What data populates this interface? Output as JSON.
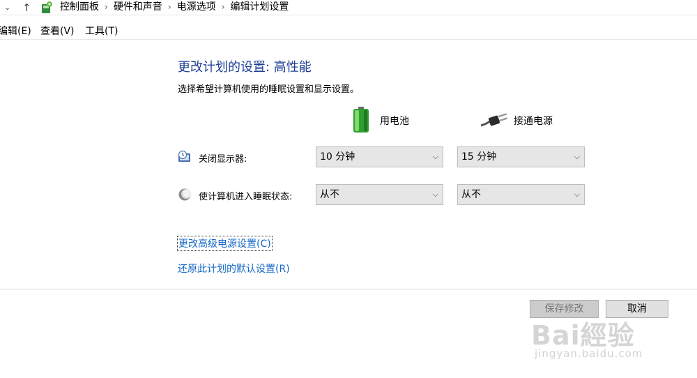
{
  "address_bar": {
    "down_glyph": "⌄",
    "up_glyph": "↑",
    "breadcrumbs": [
      "控制面板",
      "硬件和声音",
      "电源选项",
      "编辑计划设置"
    ],
    "separator": "›"
  },
  "menu": {
    "items": [
      "编辑(E)",
      "查看(V)",
      "工具(T)"
    ]
  },
  "main": {
    "title": "更改计划的设置: 高性能",
    "subtitle": "选择希望计算机使用的睡眠设置和显示设置。",
    "columns": {
      "battery": "用电池",
      "plugged_in": "接通电源"
    },
    "rows": [
      {
        "label": "关闭显示器:",
        "battery_value": "10 分钟",
        "ac_value": "15 分钟",
        "icon": "monitor-clock-icon"
      },
      {
        "label": "使计算机进入睡眠状态:",
        "battery_value": "从不",
        "ac_value": "从不",
        "icon": "moon-sleep-icon"
      }
    ],
    "links": {
      "advanced": "更改高级电源设置(C)",
      "restore": "还原此计划的默认设置(R)"
    }
  },
  "footer": {
    "save_label": "保存修改",
    "cancel_label": "取消"
  },
  "watermark": {
    "main": "Bai經验",
    "sub": "jingyan.baidu.com"
  },
  "colors": {
    "title": "#1e3f96",
    "link": "#1669c6",
    "select_bg": "#e6e6e6"
  },
  "icons": {
    "chevron": "⌵"
  }
}
